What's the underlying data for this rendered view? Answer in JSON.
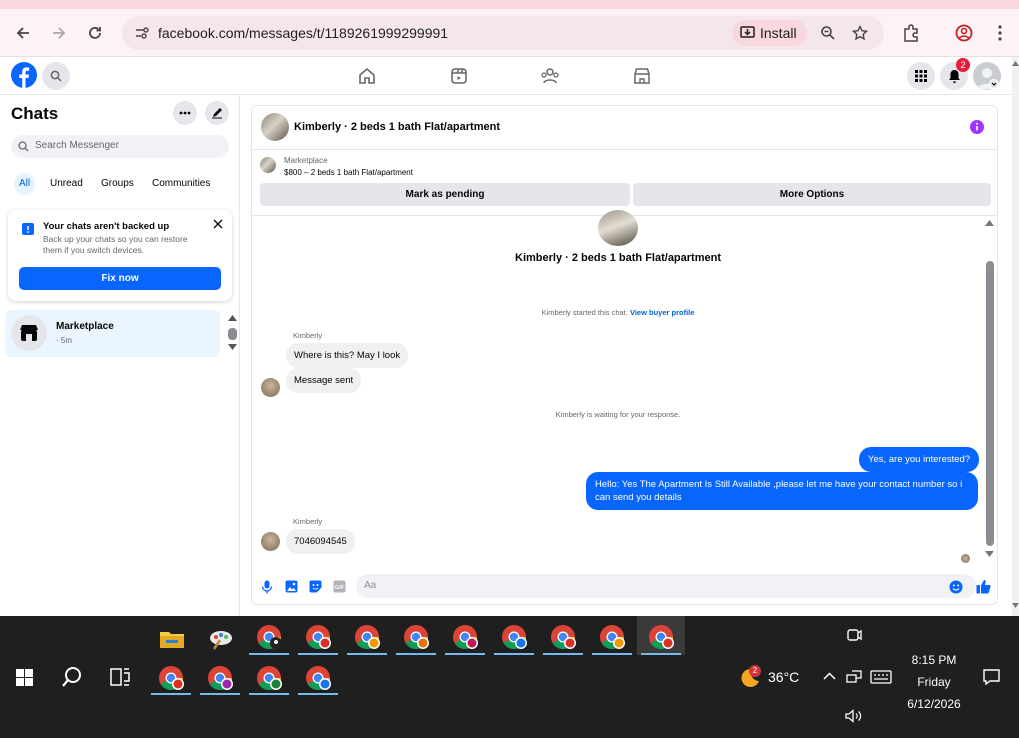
{
  "browser": {
    "url": "facebook.com/messages/t/1189261999299991",
    "install_label": "Install"
  },
  "fb": {
    "notification_count": "2"
  },
  "sidebar": {
    "title": "Chats",
    "search_placeholder": "Search Messenger",
    "filters": [
      "All",
      "Unread",
      "Groups",
      "Communities"
    ],
    "backup": {
      "title": "Your chats aren't backed up",
      "subtitle": "Back up your chats so you can restore them if you switch devices.",
      "button": "Fix now"
    },
    "chats": [
      {
        "name": "Marketplace",
        "time": "· 5m"
      }
    ]
  },
  "chat": {
    "title": "Kimberly · 2 beds 1 bath Flat/apartment",
    "marketplace_label": "Marketplace",
    "listing": "$800 – 2 beds 1 bath Flat/apartment",
    "mark_pending": "Mark as pending",
    "more_options": "More Options",
    "thread_title": "Kimberly · 2 beds 1 bath Flat/apartment",
    "started_text": "Kimberly started this chat.",
    "view_profile": "View buyer profile",
    "sender_name": "Kimberly",
    "msg_in_1": "Where is this?  May I look",
    "msg_in_2": "Message sent",
    "waiting_text": "Kimberly is waiting for your response.",
    "msg_out_1": "Yes, are you interested?",
    "msg_out_2": "Hello: Yes The Apartment Is Still Available ,please let me have your contact number so i can send you details",
    "sender_name_2": "Kimberly",
    "msg_in_3": "7046094545",
    "composer_placeholder": "Aa"
  },
  "taskbar": {
    "weather_badge": "2",
    "temperature": "36°C",
    "time": "8:15 PM",
    "day": "Friday",
    "date": "6/12/2026"
  }
}
